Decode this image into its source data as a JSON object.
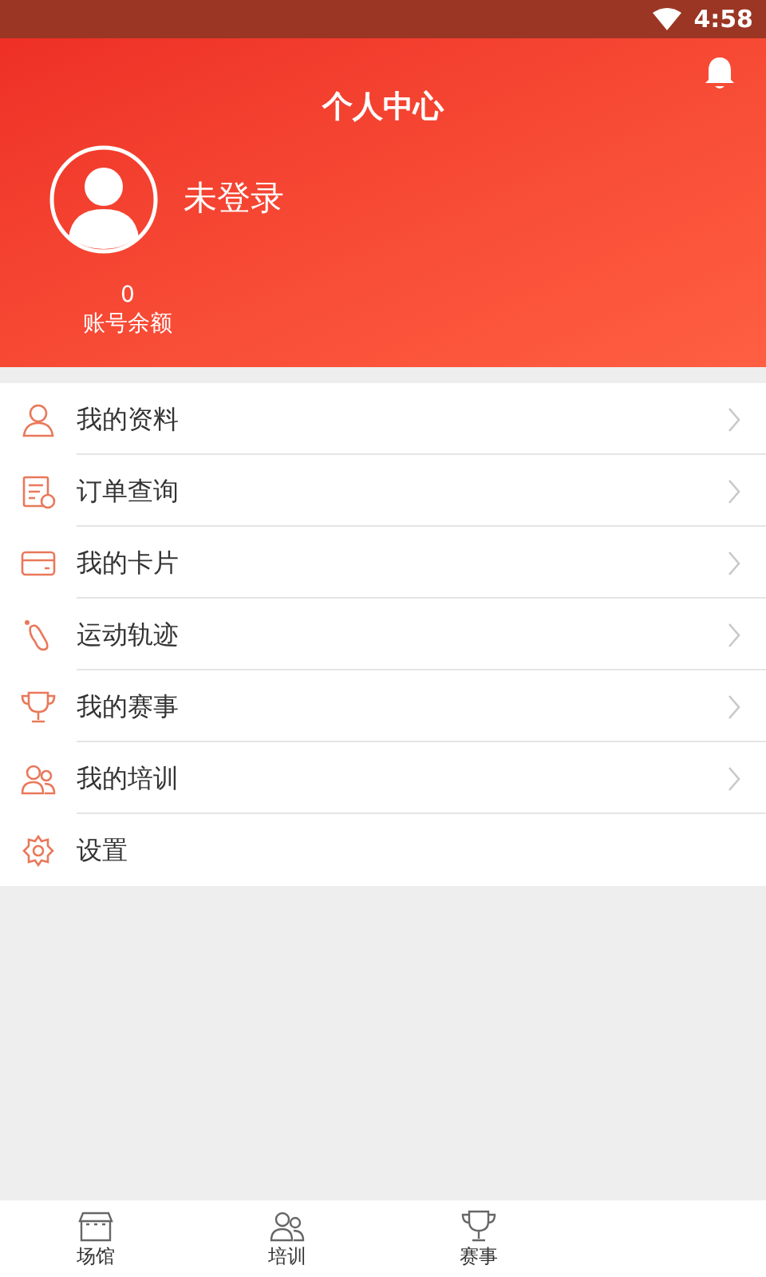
{
  "status_bar": {
    "time": "4:58"
  },
  "header": {
    "title": "个人中心",
    "username": "未登录",
    "balance": "0",
    "balance_label": "账号余额"
  },
  "menu": [
    {
      "kind": "person",
      "label": "我的资料",
      "chevron": true
    },
    {
      "kind": "order",
      "label": "订单查询",
      "chevron": true
    },
    {
      "kind": "card",
      "label": "我的卡片",
      "chevron": true
    },
    {
      "kind": "foot",
      "label": "运动轨迹",
      "chevron": true
    },
    {
      "kind": "trophy",
      "label": "我的赛事",
      "chevron": true
    },
    {
      "kind": "people",
      "label": "我的培训",
      "chevron": true
    },
    {
      "kind": "gear",
      "label": "设置",
      "chevron": false
    }
  ],
  "bottom_nav": [
    {
      "kind": "store",
      "label": "场馆"
    },
    {
      "kind": "people",
      "label": "培训"
    },
    {
      "kind": "trophy",
      "label": "赛事"
    }
  ]
}
